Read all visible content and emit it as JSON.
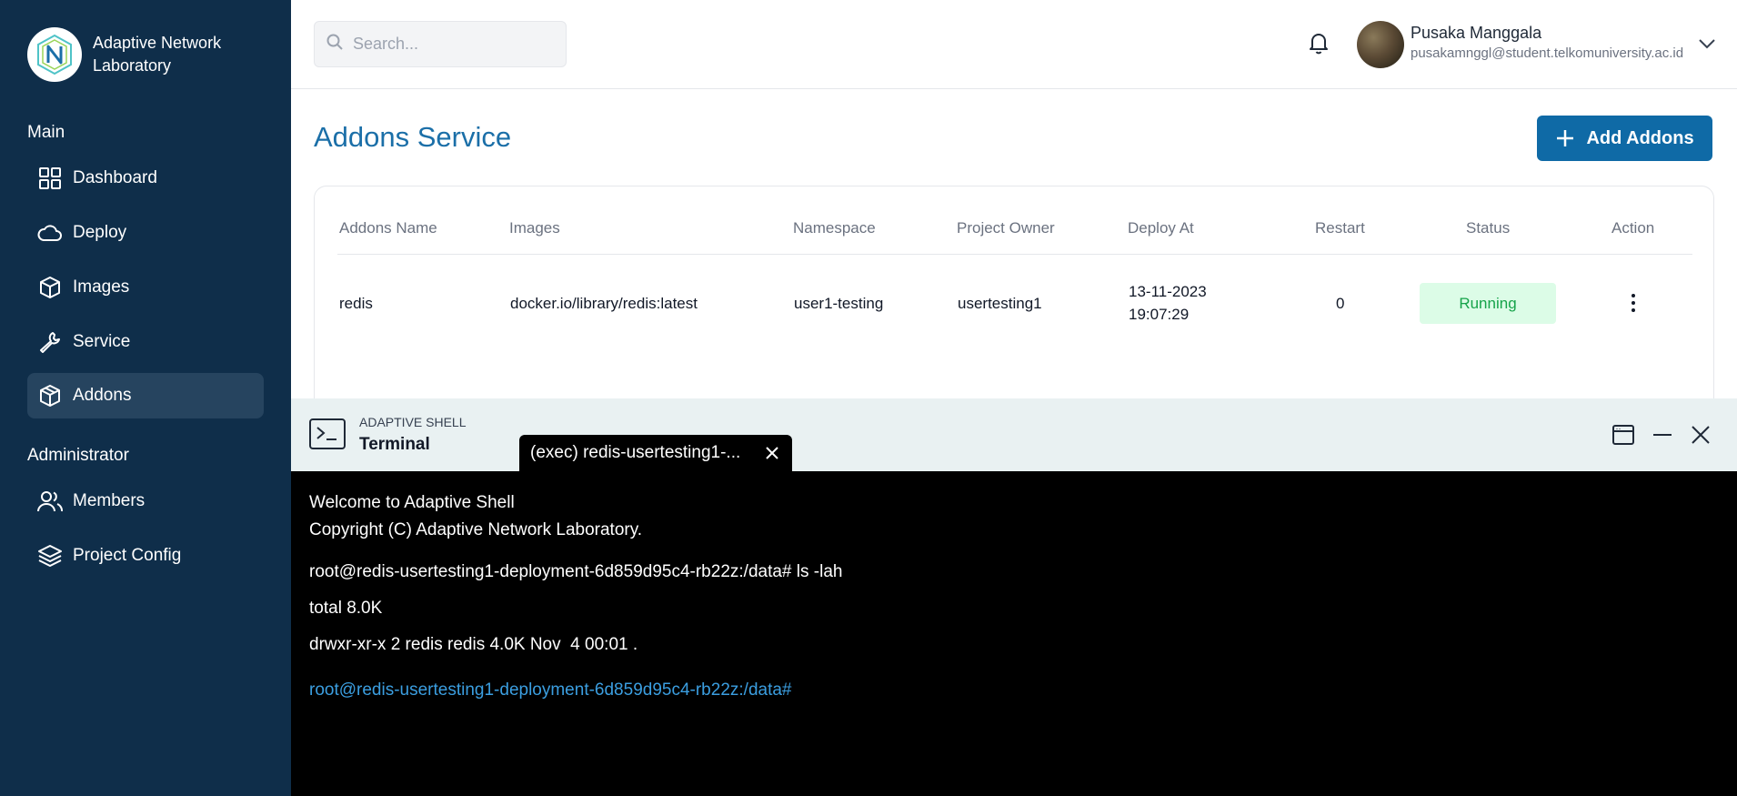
{
  "brand": {
    "name": "Adaptive Network Laboratory"
  },
  "sidebar": {
    "section_main": "Main",
    "section_admin": "Administrator",
    "items": [
      {
        "label": "Dashboard",
        "icon": "grid-icon"
      },
      {
        "label": "Deploy",
        "icon": "cloud-icon"
      },
      {
        "label": "Images",
        "icon": "cube-icon"
      },
      {
        "label": "Service",
        "icon": "wrench-icon"
      },
      {
        "label": "Addons",
        "icon": "package-icon",
        "active": true
      }
    ],
    "admin_items": [
      {
        "label": "Members",
        "icon": "users-icon"
      },
      {
        "label": "Project Config",
        "icon": "layers-icon"
      }
    ]
  },
  "header": {
    "search_placeholder": "Search...",
    "user": {
      "name": "Pusaka Manggala",
      "email": "pusakamnggl@student.telkomuniversity.ac.id"
    }
  },
  "page": {
    "title": "Addons Service",
    "add_button": "Add Addons"
  },
  "table": {
    "columns": [
      "Addons Name",
      "Images",
      "Namespace",
      "Project Owner",
      "Deploy At",
      "Restart",
      "Status",
      "Action"
    ],
    "rows": [
      {
        "name": "redis",
        "image": "docker.io/library/redis:latest",
        "namespace": "user1-testing",
        "owner": "usertesting1",
        "deploy_date": "13-11-2023",
        "deploy_time": "19:07:29",
        "restart": "0",
        "status": "Running"
      }
    ]
  },
  "terminal": {
    "small_label": "ADAPTIVE SHELL",
    "title": "Terminal",
    "tab_label": "(exec) redis-usertesting1-...",
    "lines": [
      "Welcome to Adaptive Shell",
      "Copyright (C) Adaptive Network Laboratory.",
      "root@redis-usertesting1-deployment-6d859d95c4-rb22z:/data# ls -lah",
      "total 8.0K",
      "drwxr-xr-x 2 redis redis 4.0K Nov  4 00:01 ."
    ],
    "prompt": "root@redis-usertesting1-deployment-6d859d95c4-rb22z:/data#"
  },
  "colors": {
    "sidebar_bg": "#0f2e4a",
    "accent": "#0f6aa6",
    "status_running_bg": "#dcfce7",
    "status_running_text": "#16a34a",
    "prompt": "#3b9ee0"
  }
}
